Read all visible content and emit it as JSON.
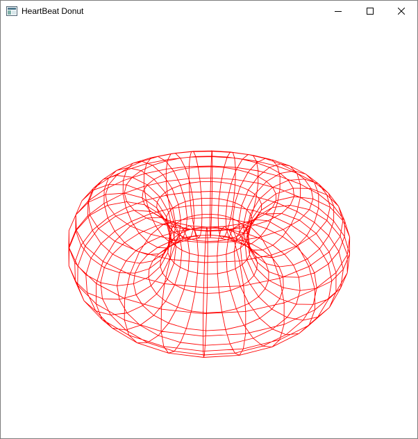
{
  "window": {
    "title": "HeartBeat Donut",
    "icon": "app-window-icon",
    "buttons": {
      "minimize": "minimize-icon",
      "maximize": "maximize-icon",
      "close": "close-icon"
    }
  },
  "scene": {
    "object": "torus-wireframe",
    "wire_color": "#ff0000",
    "background_color": "#ffffff"
  }
}
